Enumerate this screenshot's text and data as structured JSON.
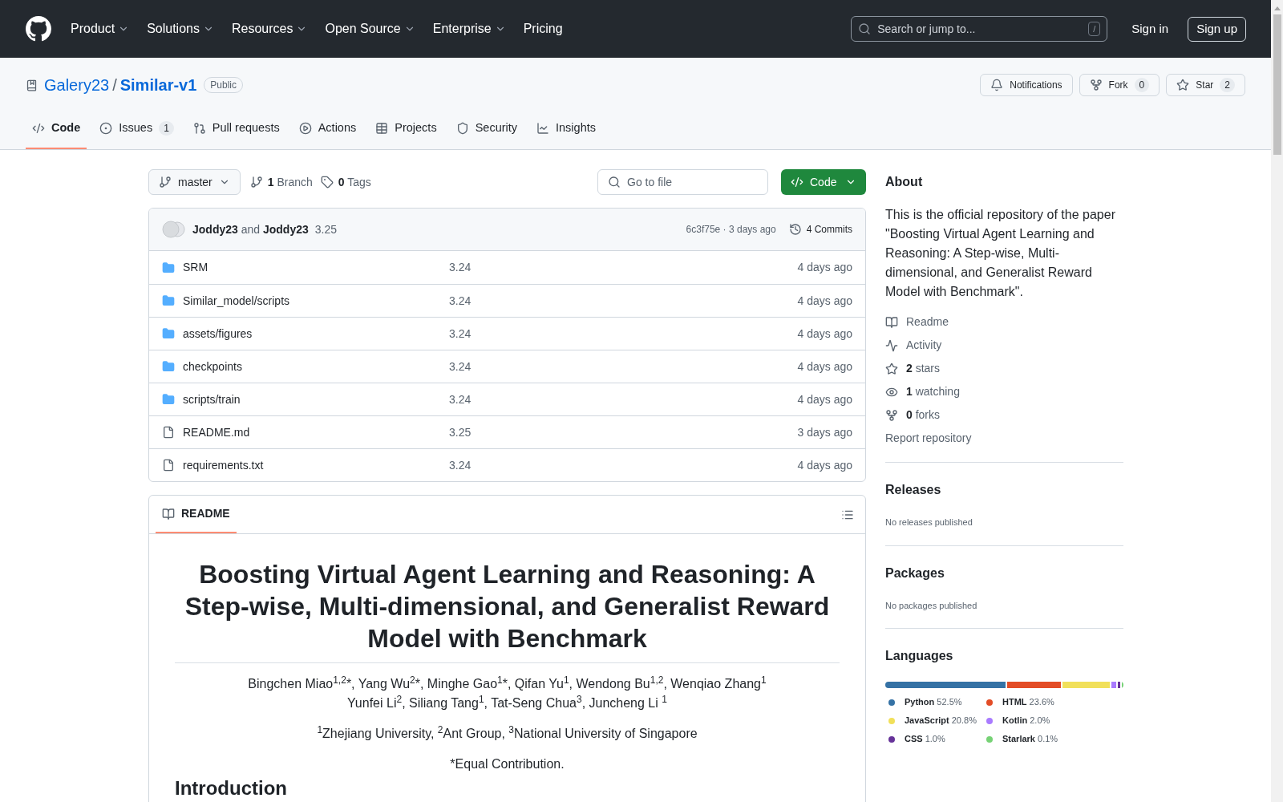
{
  "top_nav": {
    "items": [
      {
        "label": "Product",
        "dropdown": true
      },
      {
        "label": "Solutions",
        "dropdown": true
      },
      {
        "label": "Resources",
        "dropdown": true
      },
      {
        "label": "Open Source",
        "dropdown": true
      },
      {
        "label": "Enterprise",
        "dropdown": true
      },
      {
        "label": "Pricing",
        "dropdown": false
      }
    ],
    "search": {
      "placeholder": "Search or jump to...",
      "shortcut": "/"
    },
    "sign_in": "Sign in",
    "sign_up": "Sign up"
  },
  "repo": {
    "owner": "Galery23",
    "separator": "/",
    "name": "Similar-v1",
    "visibility": "Public",
    "actions": [
      {
        "kind": "notifications",
        "label": "Notifications"
      },
      {
        "kind": "fork",
        "label": "Fork",
        "count": "0"
      },
      {
        "kind": "star",
        "label": "Star",
        "count": "2"
      }
    ]
  },
  "tabs": [
    {
      "kind": "code",
      "label": "Code",
      "selected": true
    },
    {
      "kind": "issues",
      "label": "Issues",
      "count": "1",
      "selected": false
    },
    {
      "kind": "pulls",
      "label": "Pull requests",
      "selected": false
    },
    {
      "kind": "actions",
      "label": "Actions",
      "selected": false
    },
    {
      "kind": "projects",
      "label": "Projects",
      "selected": false
    },
    {
      "kind": "security",
      "label": "Security",
      "selected": false
    },
    {
      "kind": "insights",
      "label": "Insights",
      "selected": false
    }
  ],
  "toolbar": {
    "branch": "master",
    "branches_count": "1",
    "branches_label": "Branch",
    "tags_count": "0",
    "tags_label": "Tags",
    "go_to_file": "Go to file",
    "code_button": "Code"
  },
  "commit": {
    "author1": "Joddy23",
    "and": "and",
    "author2": "Joddy23",
    "message": "3.25",
    "sha": "6c3f75e · 3 days ago",
    "commits": "4 Commits"
  },
  "files": [
    {
      "kind": "folder",
      "name": "SRM",
      "message": "3.24",
      "age": "4 days ago"
    },
    {
      "kind": "folder",
      "name": "Similar_model/scripts",
      "message": "3.24",
      "age": "4 days ago"
    },
    {
      "kind": "folder",
      "name": "assets/figures",
      "message": "3.24",
      "age": "4 days ago"
    },
    {
      "kind": "folder",
      "name": "checkpoints",
      "message": "3.24",
      "age": "4 days ago"
    },
    {
      "kind": "folder",
      "name": "scripts/train",
      "message": "3.24",
      "age": "4 days ago"
    },
    {
      "kind": "file",
      "name": "README.md",
      "message": "3.25",
      "age": "3 days ago"
    },
    {
      "kind": "file",
      "name": "requirements.txt",
      "message": "3.24",
      "age": "4 days ago"
    }
  ],
  "readme": {
    "tab": "README",
    "title": "Boosting Virtual Agent Learning and Reasoning: A Step-wise, Multi-dimensional, and Generalist Reward Model with Benchmark",
    "authors": [
      [
        "Bingchen Miao$^{1,2}$*",
        ", Yang Wu$^{2}$*",
        ", Minghe Gao$^{1}$*, Qifan Yu$^{1}$, Wendong Bu$^{1,2}$, Wenqiao Zhang$^{1}$"
      ],
      [
        "Yunfei Li$^{2}$, Siliang Tang$^{1}$, Tat-Seng Chua$^{3}$, Juncheng Li $^{1}$"
      ]
    ],
    "affiliations": "$^{1}$Zhejiang University, $^{2}$Ant Group, $^{3}$National University of Singapore",
    "note": "*Equal Contribution.",
    "section": "Introduction"
  },
  "about": {
    "title": "About",
    "description": "This is the official repository of the paper \"Boosting Virtual Agent Learning and Reasoning: A Step-wise, Multi-dimensional, and Generalist Reward Model with Benchmark\".",
    "links": [
      {
        "kind": "readme",
        "label": "Readme"
      },
      {
        "kind": "activity",
        "label": "Activity"
      },
      {
        "kind": "stars",
        "count": "2",
        "label": "stars"
      },
      {
        "kind": "watching",
        "count": "1",
        "label": "watching"
      },
      {
        "kind": "forks",
        "count": "0",
        "label": "forks"
      },
      {
        "kind": "report",
        "label": "Report repository"
      }
    ]
  },
  "releases": {
    "title": "Releases",
    "text": "No releases published"
  },
  "packages": {
    "title": "Packages",
    "text": "No packages published"
  },
  "languages": {
    "title": "Languages",
    "items": [
      {
        "name": "Python",
        "percent": "52.5%",
        "color": "#3572a5"
      },
      {
        "name": "HTML",
        "percent": "23.6%",
        "color": "#e34c26"
      },
      {
        "name": "JavaScript",
        "percent": "20.8%",
        "color": "#f1e05a"
      },
      {
        "name": "Kotlin",
        "percent": "2.0%",
        "color": "#a97bff"
      },
      {
        "name": "CSS",
        "percent": "1.0%",
        "color": "#663399"
      },
      {
        "name": "Starlark",
        "percent": "0.1%",
        "color": "#76d275"
      }
    ]
  }
}
